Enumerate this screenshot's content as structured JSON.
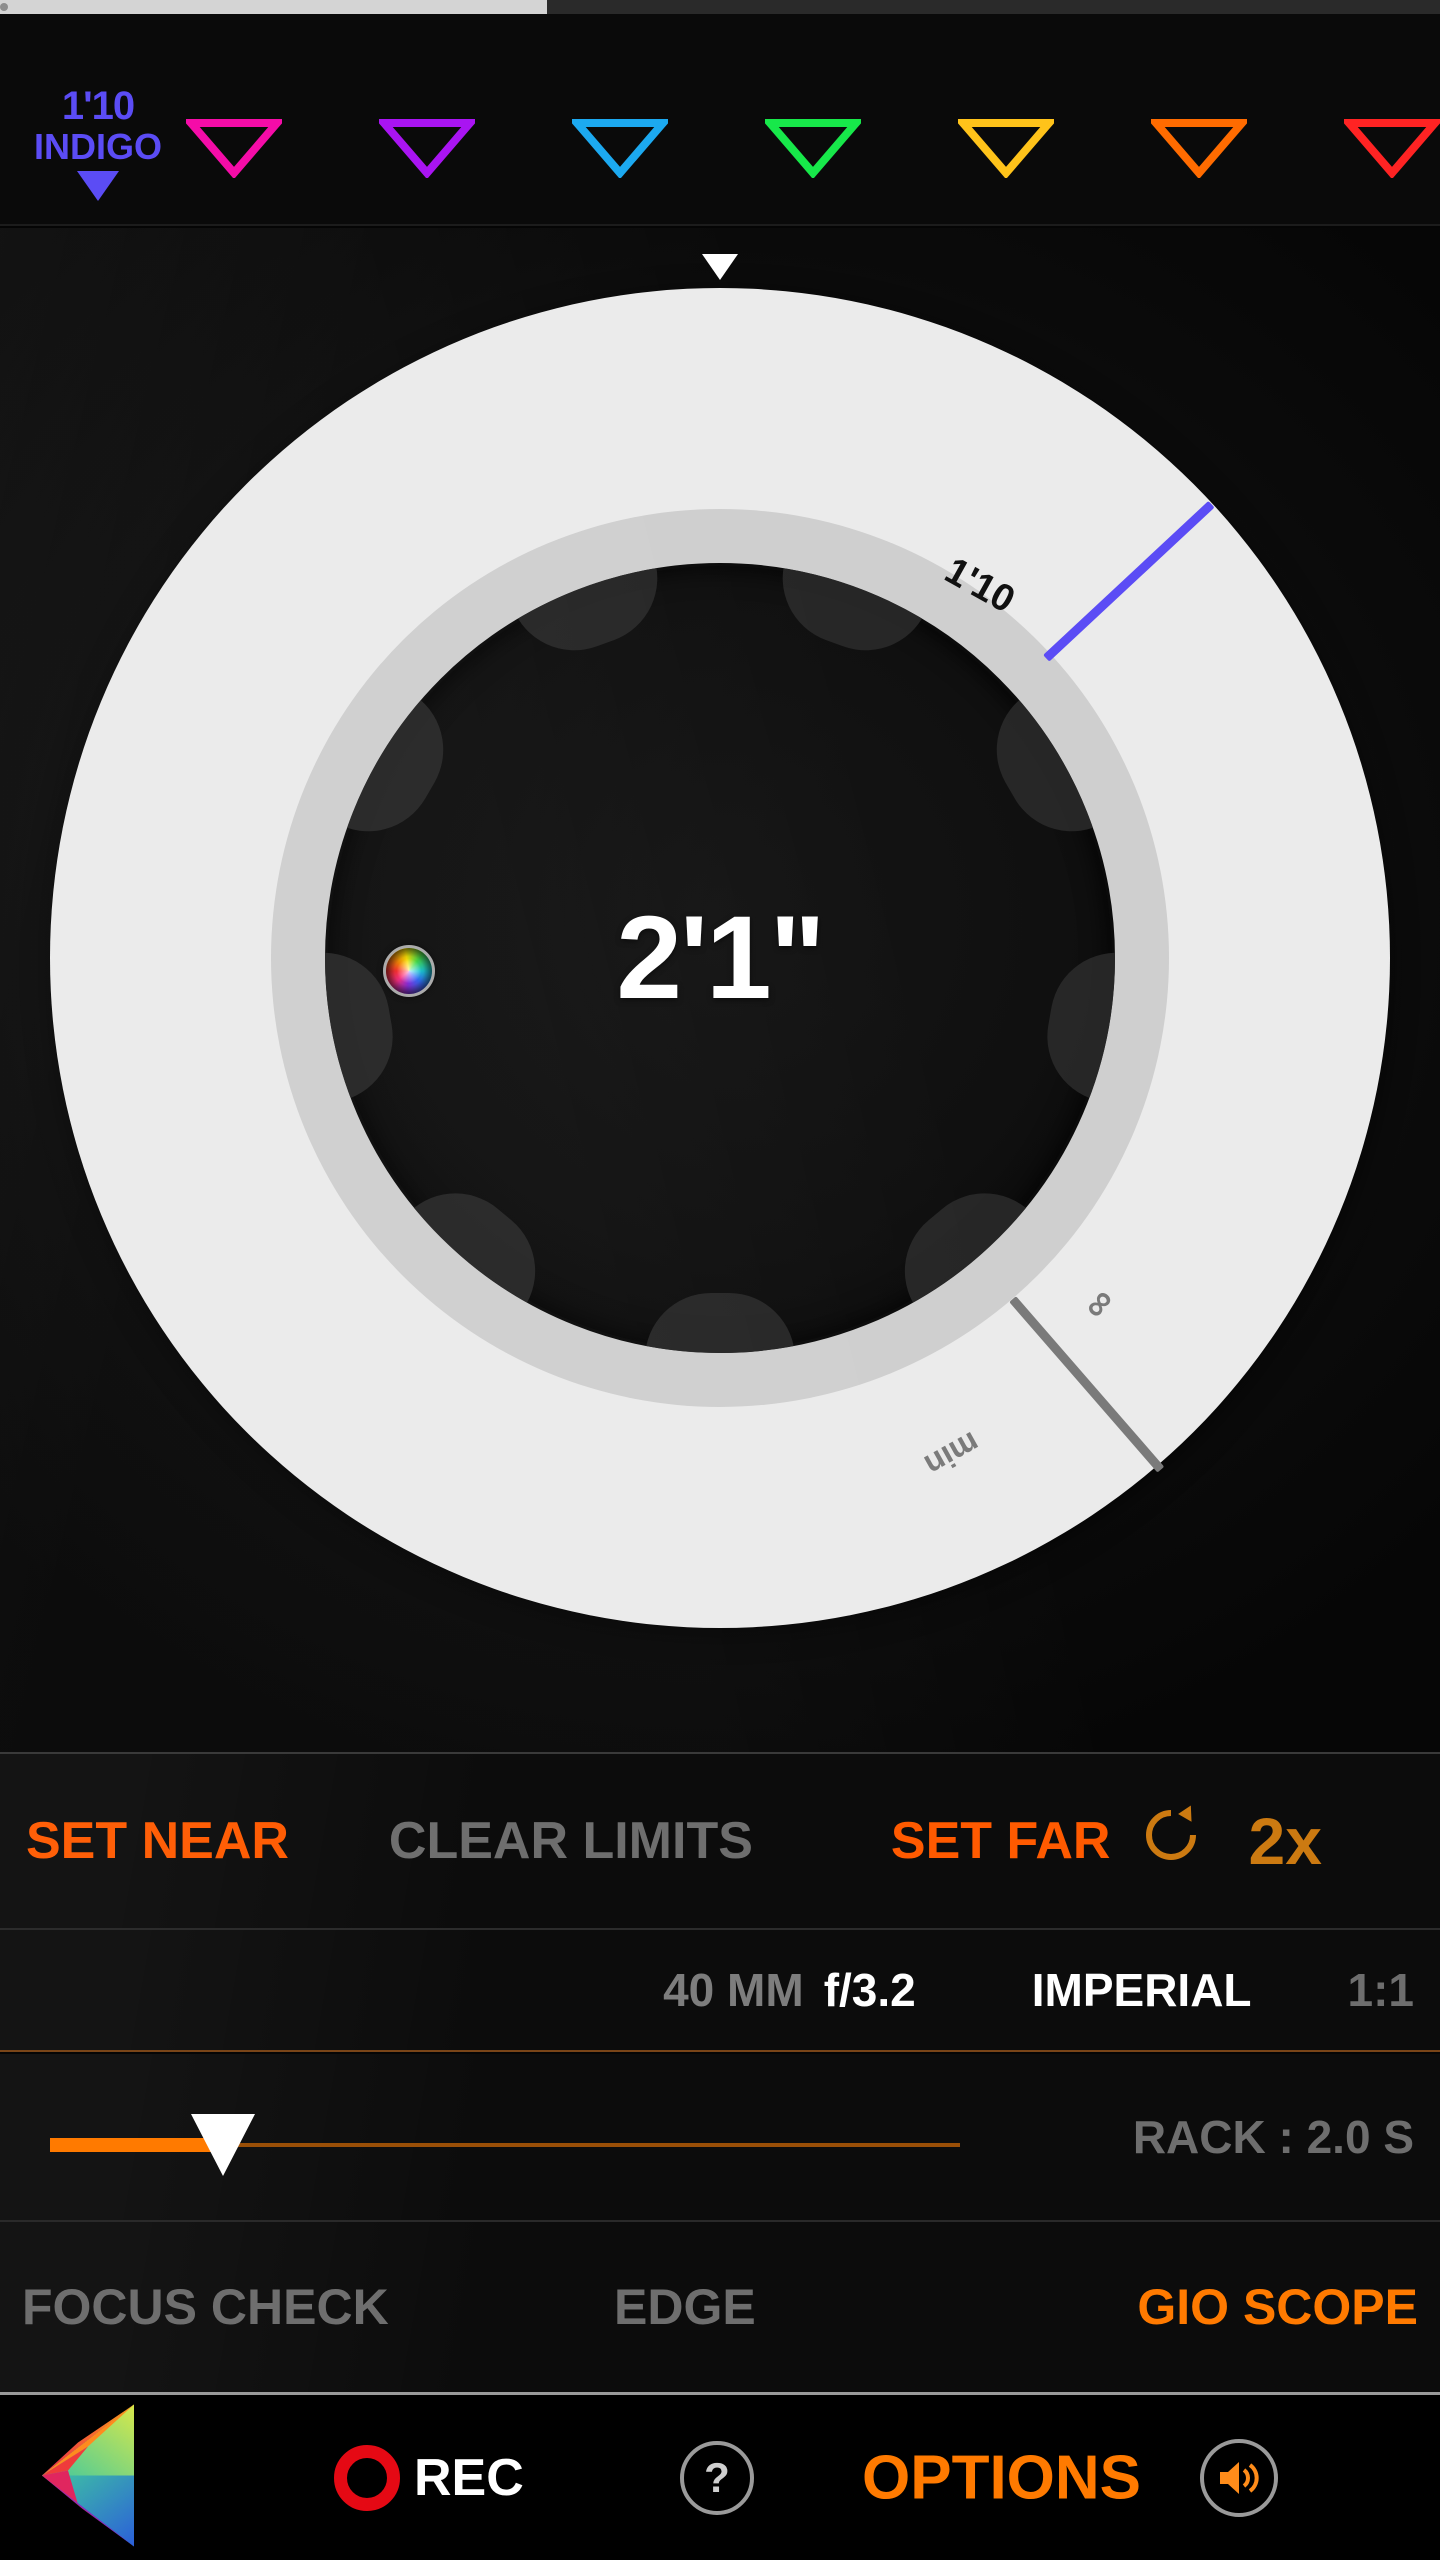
{
  "top_scrubber": {
    "fill_percent": 38,
    "name": "timeline-scrubber"
  },
  "markers": {
    "active": {
      "distance": "1'10",
      "name": "INDIGO",
      "color": "#5b4cf5"
    },
    "triangles": [
      {
        "name": "MAGENTA",
        "color": "#f50ca8"
      },
      {
        "name": "VIOLET",
        "color": "#a914f2"
      },
      {
        "name": "BLUE",
        "color": "#1ca9f0"
      },
      {
        "name": "GREEN",
        "color": "#17e84a"
      },
      {
        "name": "YELLOW",
        "color": "#ffc31a"
      },
      {
        "name": "ORANGE",
        "color": "#ff6b00"
      },
      {
        "name": "RED",
        "color": "#ff2323"
      }
    ]
  },
  "dial": {
    "center_value": "2'1\"",
    "top_index_icon": "down-caret-icon",
    "color_wheel_icon": "color-wheel-icon",
    "marks": [
      {
        "label": "1'10",
        "color": "#111111",
        "line_color": "#5b4cf5",
        "angle": -43
      },
      {
        "label": "∞",
        "color": "#7a7a7a",
        "line_color": "#7a7a7a",
        "angle": 49
      },
      {
        "label": "min",
        "color": "#7a7a7a",
        "line_color": "#7a7a7a",
        "angle": 57
      }
    ]
  },
  "limits_row": {
    "set_near": "SET NEAR",
    "clear_limits": "CLEAR LIMITS",
    "set_far": "SET FAR",
    "loop_icon": "refresh-loop-icon",
    "multiplier": "2x"
  },
  "lens_row": {
    "focal_length": "40 MM",
    "aperture": "f/3.2",
    "units": "IMPERIAL",
    "ratio": "1:1"
  },
  "rack_row": {
    "slider_percent": 19,
    "label": "RACK : 2.0 S"
  },
  "tools_row": {
    "focus_check": "FOCUS CHECK",
    "edge": "EDGE",
    "gio_scope": "GIO SCOPE"
  },
  "navbar": {
    "prism_icon": "prism-logo-icon",
    "rec_icon": "record-circle-icon",
    "rec_label": "REC",
    "help_icon": "question-mark-icon",
    "help_label": "?",
    "options_label": "OPTIONS",
    "speaker_icon": "speaker-volume-icon"
  },
  "colors": {
    "accent_orange": "#ff7a00",
    "set_orange": "#ff5a00",
    "dim_gray": "#6e6e6e",
    "dial_outer": "#ebebeb",
    "dial_inner": "#cfcfcf",
    "rec_red": "#e50914"
  }
}
